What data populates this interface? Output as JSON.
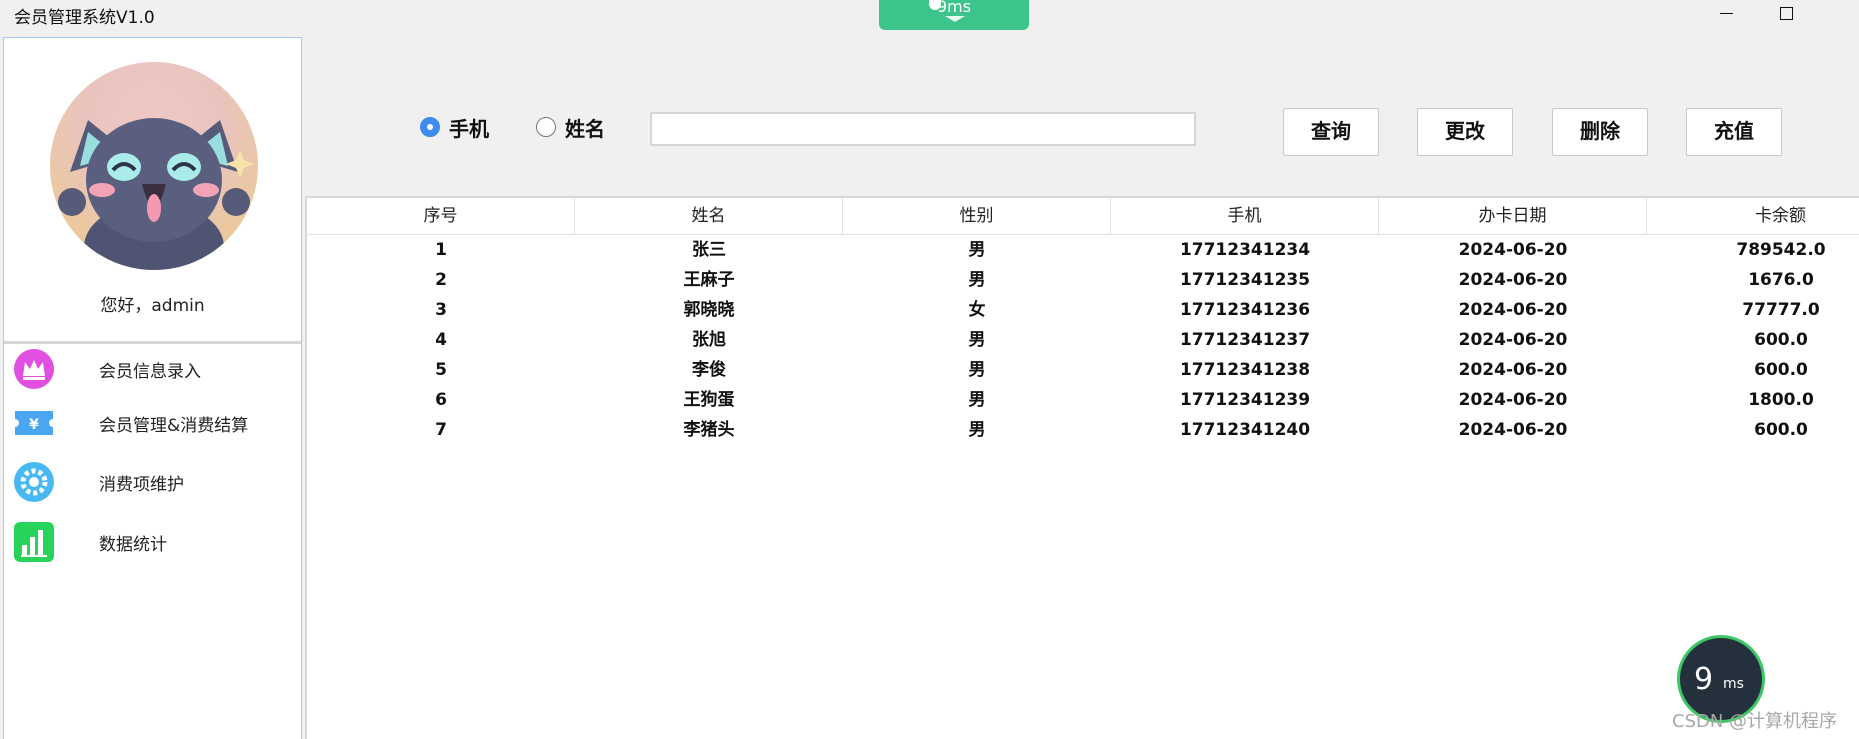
{
  "window": {
    "title": "会员管理系统V1.0",
    "minimize_glyph": "minimize-icon",
    "maximize_glyph": "maximize-icon"
  },
  "latency_pill": {
    "text": "9ms",
    "color": "#3cc48a"
  },
  "sidebar": {
    "greeting": "您好，admin",
    "items": [
      {
        "label": "会员信息录入",
        "icon": "crown-icon",
        "color": "#e14fe0"
      },
      {
        "label": "会员管理&消费结算",
        "icon": "yuan-ticket-icon",
        "color": "#4aa6f0"
      },
      {
        "label": "消费项维护",
        "icon": "gear-icon",
        "color": "#48b8f2"
      },
      {
        "label": "数据统计",
        "icon": "bar-chart-icon",
        "color": "#27d35a"
      }
    ]
  },
  "search": {
    "radio_phone": "手机",
    "radio_name": "姓名",
    "selected": "手机",
    "input_value": "",
    "input_placeholder": ""
  },
  "buttons": {
    "query": "查询",
    "edit": "更改",
    "delete": "删除",
    "recharge": "充值"
  },
  "table": {
    "columns": [
      "序号",
      "姓名",
      "性别",
      "手机",
      "办卡日期",
      "卡余额"
    ],
    "rows": [
      [
        "1",
        "张三",
        "男",
        "17712341234",
        "2024-06-20",
        "789542.0"
      ],
      [
        "2",
        "王麻子",
        "男",
        "17712341235",
        "2024-06-20",
        "1676.0"
      ],
      [
        "3",
        "郭晓晓",
        "女",
        "17712341236",
        "2024-06-20",
        "77777.0"
      ],
      [
        "4",
        "张旭",
        "男",
        "17712341237",
        "2024-06-20",
        "600.0"
      ],
      [
        "5",
        "李俊",
        "男",
        "17712341238",
        "2024-06-20",
        "600.0"
      ],
      [
        "6",
        "王狗蛋",
        "男",
        "17712341239",
        "2024-06-20",
        "1800.0"
      ],
      [
        "7",
        "李猪头",
        "男",
        "17712341240",
        "2024-06-20",
        "600.0"
      ]
    ]
  },
  "ms_badge": {
    "value": "9",
    "unit": "ms"
  },
  "watermark": "CSDN @计算机程序"
}
